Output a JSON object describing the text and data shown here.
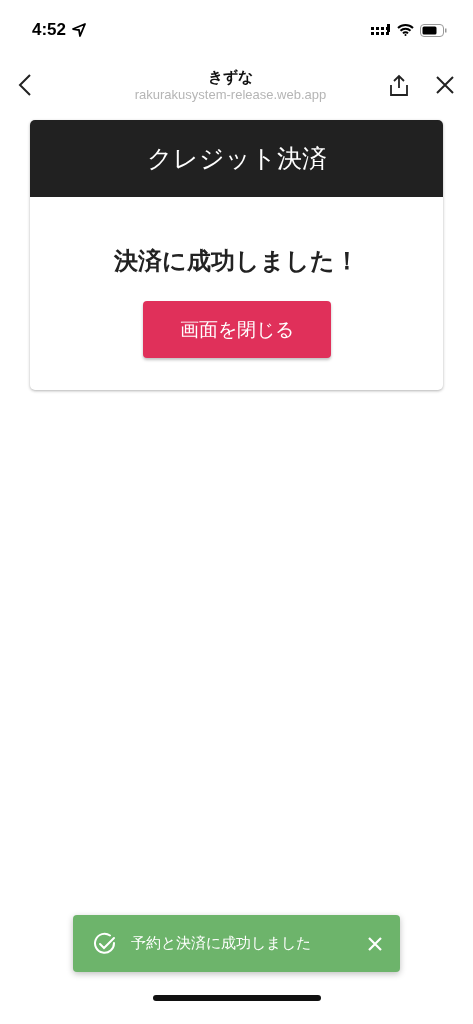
{
  "status_bar": {
    "time": "4:52"
  },
  "nav": {
    "title": "きずな",
    "url": "rakurakusystem-release.web.app"
  },
  "card": {
    "title": "クレジット決済",
    "message": "決済に成功しました！",
    "button": "画面を閉じる"
  },
  "toast": {
    "message": "予約と決済に成功しました"
  }
}
